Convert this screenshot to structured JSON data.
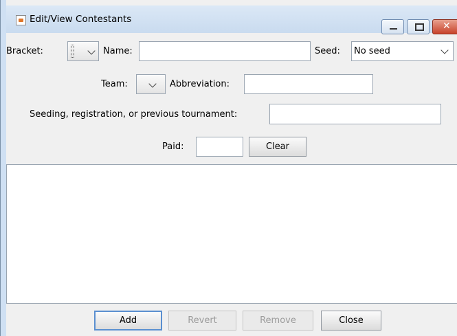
{
  "window": {
    "title": "Edit/View Contestants"
  },
  "row1": {
    "bracket_label": "Bracket:",
    "name_label": "Name:",
    "name_value": "",
    "seed_label": "Seed:",
    "seed_value": "No seed"
  },
  "row2": {
    "team_label": "Team:",
    "abbreviation_label": "Abbreviation:",
    "abbreviation_value": ""
  },
  "row3": {
    "seeding_label": "Seeding, registration, or previous tournament:",
    "seeding_value": ""
  },
  "row4": {
    "paid_label": "Paid:",
    "paid_value": "",
    "clear_label": "Clear"
  },
  "buttons": {
    "add": "Add",
    "revert": "Revert",
    "remove": "Remove",
    "close": "Close"
  }
}
